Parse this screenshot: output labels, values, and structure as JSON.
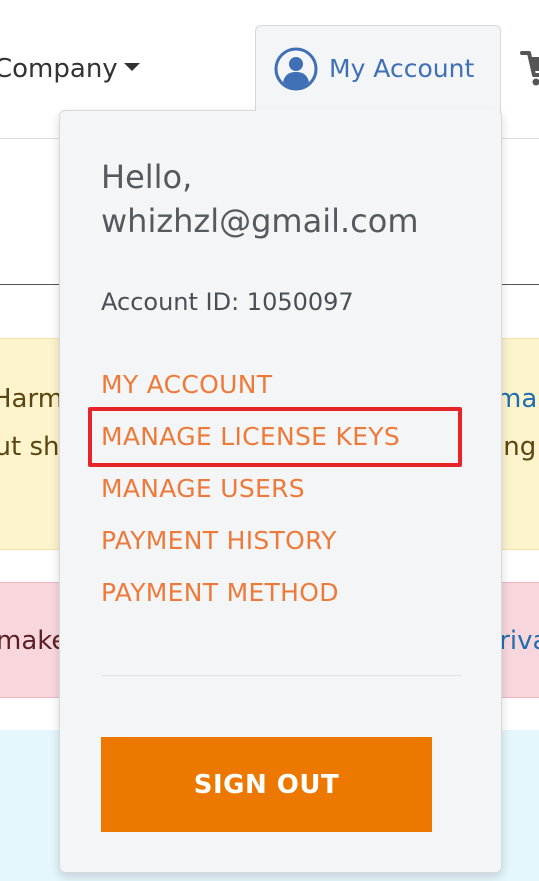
{
  "nav": {
    "company_label": "Company",
    "account_label": "My Account"
  },
  "icons": {
    "account": "user-circle-icon",
    "caret": "caret-down-icon",
    "cart": "shopping-cart-icon"
  },
  "colors": {
    "link": "#ee7a3a",
    "account_blue": "#3f6fb5",
    "signout_bg": "#ec7800",
    "highlight": "#e8242a",
    "yellow_notice": "#fdf3cd",
    "red_notice": "#f8d7dc",
    "blue_info": "#e5f6fd"
  },
  "background": {
    "yellow_notice": {
      "line1_left": "Harmoni",
      "line2_left": "but sh",
      "line1_right": "mana",
      "line2_right": "ing"
    },
    "red_notice": {
      "left": "make",
      "right": "Privacy"
    }
  },
  "dropdown": {
    "greeting_line1": "Hello,",
    "greeting_line2": "whizhzl@gmail.com",
    "account_id": "Account ID: 1050097",
    "menu": [
      {
        "label": "MY ACCOUNT"
      },
      {
        "label": "MANAGE LICENSE KEYS",
        "highlighted": true
      },
      {
        "label": "MANAGE USERS"
      },
      {
        "label": "PAYMENT HISTORY"
      },
      {
        "label": "PAYMENT METHOD"
      }
    ],
    "signout_label": "SIGN OUT"
  }
}
